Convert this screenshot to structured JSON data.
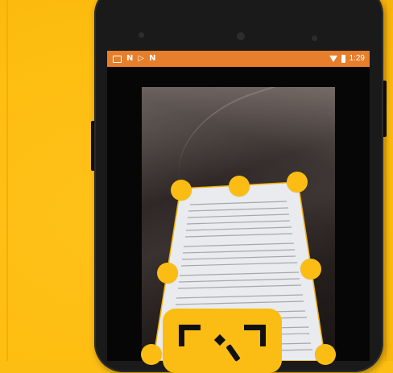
{
  "status_bar": {
    "left_icons": [
      "gallery-icon",
      "n-icon",
      "play-store-icon",
      "n-icon"
    ],
    "left_glyphs": [
      "N",
      "▷",
      "N"
    ],
    "time": "1:29",
    "right_icons": [
      "wifi-icon",
      "battery-icon"
    ]
  },
  "colors": {
    "background": "#FCBE12",
    "status_bar": "#E67E2B",
    "handle": "#FBBD13",
    "crop_outline": "#F5B100"
  },
  "app_logo": {
    "icon": "scan-frame-icon"
  }
}
